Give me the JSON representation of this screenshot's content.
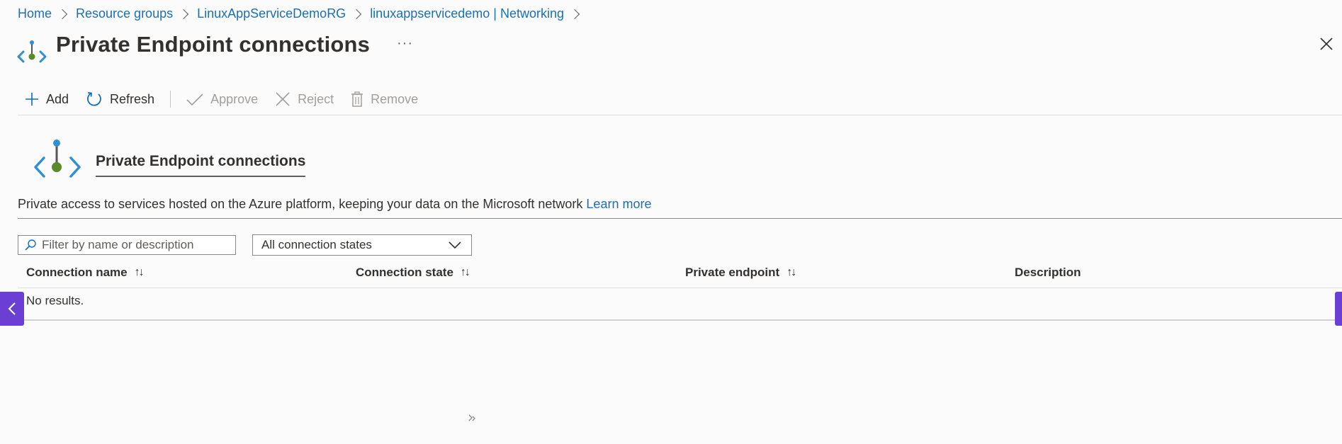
{
  "breadcrumb": [
    {
      "label": "Home"
    },
    {
      "label": "Resource groups"
    },
    {
      "label": "LinuxAppServiceDemoRG"
    },
    {
      "label": "linuxappservicedemo | Networking"
    }
  ],
  "page": {
    "title": "Private Endpoint connections",
    "more_label": "···"
  },
  "toolbar": {
    "add_label": "Add",
    "refresh_label": "Refresh",
    "approve_label": "Approve",
    "reject_label": "Reject",
    "remove_label": "Remove"
  },
  "section": {
    "title": "Private Endpoint connections",
    "description": "Private access to services hosted on the Azure platform, keeping your data on the Microsoft network",
    "learn_more": "Learn more"
  },
  "filter": {
    "placeholder": "Filter by name or description",
    "value": ""
  },
  "state_select": {
    "selected": "All connection states"
  },
  "table": {
    "columns": [
      {
        "label": "Connection name",
        "sort": "↑↓"
      },
      {
        "label": "Connection state",
        "sort": "↑↓"
      },
      {
        "label": "Private endpoint",
        "sort": "↑↓"
      },
      {
        "label": "Description",
        "sort": ""
      }
    ],
    "empty_message": "No results."
  },
  "colors": {
    "link": "#1a6fb5",
    "side_tab": "#6b3fd4",
    "icon_blue": "#2f8fd1",
    "icon_green": "#5b8a2a"
  }
}
